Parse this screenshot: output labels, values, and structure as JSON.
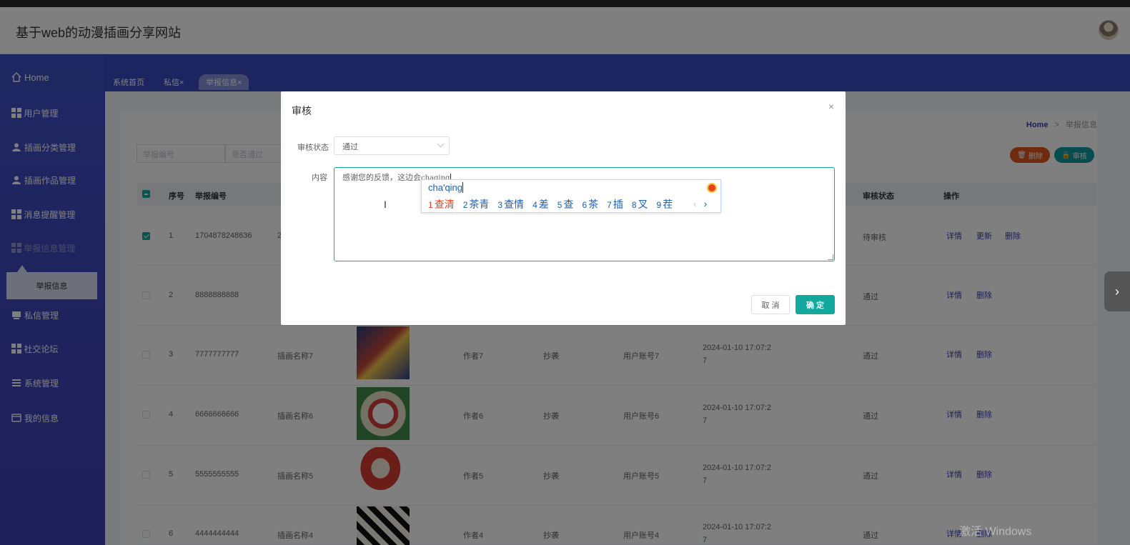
{
  "header": {
    "title": "基于web的动漫插画分享网站"
  },
  "sidebar": {
    "items": [
      {
        "label": "Home",
        "icon": "home-icon"
      },
      {
        "label": "用户管理",
        "icon": "grid-icon"
      },
      {
        "label": "插画分类管理",
        "icon": "user-icon"
      },
      {
        "label": "插画作品管理",
        "icon": "user-icon"
      },
      {
        "label": "消息提醒管理",
        "icon": "grid-icon"
      },
      {
        "label": "举报信息管理",
        "icon": "grid-icon"
      },
      {
        "label": "私信管理",
        "icon": "message-icon"
      },
      {
        "label": "社交论坛",
        "icon": "grid-icon"
      },
      {
        "label": "系统管理",
        "icon": "list-icon"
      },
      {
        "label": "我的信息",
        "icon": "card-icon"
      }
    ],
    "submenu": "举报信息"
  },
  "tabs": [
    {
      "label": "系统首页"
    },
    {
      "label": "私信×"
    },
    {
      "label": "举报信息×"
    }
  ],
  "breadcrumb": {
    "home": "Home",
    "sep": ">",
    "current": "举报信息"
  },
  "search": {
    "placeholder1": "举报编号",
    "placeholder2": "是否通过"
  },
  "actions": {
    "delete": "删除",
    "audit": "审核"
  },
  "table": {
    "headers": [
      "序号",
      "举报编号",
      "审核状态",
      "操作"
    ],
    "rows": [
      {
        "idx": "1",
        "code": "1704878248636",
        "name": "2",
        "author": "",
        "type": "",
        "account": "",
        "time1": "",
        "time2": "",
        "status": "待审核",
        "ops": [
          "详情",
          "更新",
          "删除"
        ]
      },
      {
        "idx": "2",
        "code": "8888888888",
        "name": "",
        "author": "",
        "type": "",
        "account": "",
        "time1": "",
        "time2": "",
        "status": "通过",
        "ops": [
          "详情",
          "删除"
        ]
      },
      {
        "idx": "3",
        "code": "7777777777",
        "name": "插画名称7",
        "author": "作者7",
        "type": "抄袭",
        "account": "用户账号7",
        "time1": "2024-01-10 17:07:2",
        "time2": "7",
        "status": "通过",
        "ops": [
          "详情",
          "删除"
        ]
      },
      {
        "idx": "4",
        "code": "6666666666",
        "name": "插画名称6",
        "author": "作者6",
        "type": "抄袭",
        "account": "用户账号6",
        "time1": "2024-01-10 17:07:2",
        "time2": "7",
        "status": "通过",
        "ops": [
          "详情",
          "删除"
        ]
      },
      {
        "idx": "5",
        "code": "5555555555",
        "name": "插画名称5",
        "author": "作者5",
        "type": "抄袭",
        "account": "用户账号5",
        "time1": "2024-01-10 17:07:2",
        "time2": "7",
        "status": "通过",
        "ops": [
          "详情",
          "删除"
        ]
      },
      {
        "idx": "6",
        "code": "4444444444",
        "name": "插画名称4",
        "author": "作者4",
        "type": "抄袭",
        "account": "用户账号4",
        "time1": "2024-01-10 17:07:2",
        "time2": "7",
        "status": "通过",
        "ops": [
          "详情",
          "删除"
        ]
      }
    ]
  },
  "dialog": {
    "title": "审核",
    "close": "×",
    "status_label": "审核状态",
    "status_value": "通过",
    "content_label": "内容",
    "content_text": "感谢您的反馈，这边会",
    "content_typed": "chaqing",
    "cancel": "取 消",
    "confirm": "确 定"
  },
  "ime": {
    "pinyin": "cha'qing",
    "candidates": [
      {
        "n": "1",
        "w": "查清"
      },
      {
        "n": "2",
        "w": "茶青"
      },
      {
        "n": "3",
        "w": "查情"
      },
      {
        "n": "4",
        "w": "差"
      },
      {
        "n": "5",
        "w": "查"
      },
      {
        "n": "6",
        "w": "茶"
      },
      {
        "n": "7",
        "w": "插"
      },
      {
        "n": "8",
        "w": "叉"
      },
      {
        "n": "9",
        "w": "茬"
      }
    ],
    "prev": "‹",
    "next": "›"
  },
  "watermark": "激活 Windows",
  "colors": {
    "primary": "#13a89e",
    "sidebar": "#3e3fb3",
    "danger": "#e1561e"
  }
}
